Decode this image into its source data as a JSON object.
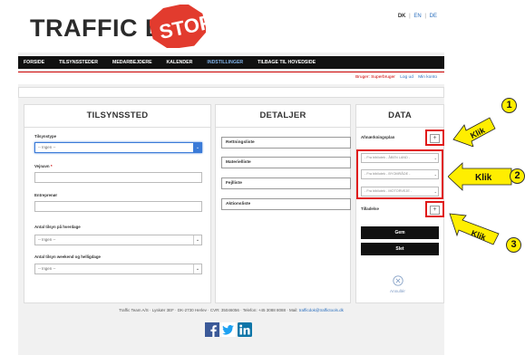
{
  "header": {
    "logo_text": "TRAFFIC DOK",
    "stop_text": "STOP",
    "lang": {
      "dk": "DK",
      "en": "EN",
      "de": "DE",
      "sep": "|"
    }
  },
  "nav": {
    "items": [
      "FORSIDE",
      "TILSYNSSTEDER",
      "MEDARBEJDERE",
      "KALENDER",
      "INDSTILLINGER",
      "TILBAGE TIL HOVEDSIDE"
    ],
    "active_index": 4
  },
  "userbar": {
    "user": "Bruger: Superbruger",
    "logout": "Log ud",
    "account": "Min konto"
  },
  "tilsynssted": {
    "title": "TILSYNSSTED",
    "tilsynstype_label": "Tilsynstype",
    "tilsynstype_value": "-- Ingen --",
    "vejnavn_label": "Vejnavn",
    "vejnavn_req": "*",
    "entreprenor_label": "Entreprenør",
    "hverdage_label": "Antal tilsyn på hverdage",
    "hverdage_value": "-- Ingen --",
    "weekend_label": "Antal tilsyn weekend og helligdage",
    "weekend_value": "-- Ingen --"
  },
  "detaljer": {
    "title": "DETALJER",
    "buttons": [
      "Rettningsliste",
      "Materielliste",
      "Fejlliste",
      "Aktionsliste"
    ]
  },
  "data": {
    "title": "DATA",
    "afmaerkning_label": "Afmærkningsplan",
    "plus": "+",
    "selects": [
      "- Fra bibliotek - ÅBEN LAND -",
      "- Fra bibliotek - BYOMRÅDE -",
      "- Fra bibliotek - MOTORVEJE -"
    ],
    "tilladelse_label": "Tilladelse",
    "gem": "Gem",
    "slet": "Slet",
    "annuller": "Annullér"
  },
  "footer": {
    "text": "Traffic Team A/S",
    "text_rest": " · Lyskær 3EF · DK-2730 Herlev · CVR: 35046056 · Telefon: +45 3088 8088 · Mail: ",
    "email": "trafficdok@traffictools.dk"
  },
  "annotations": {
    "klik": "Klik",
    "numbers": [
      "1",
      "2",
      "3"
    ]
  },
  "colors": {
    "accent": "#3b7bd8",
    "nav_bg": "#111111",
    "highlight_red": "#e01919",
    "arrow_yellow": "#ffee00"
  }
}
